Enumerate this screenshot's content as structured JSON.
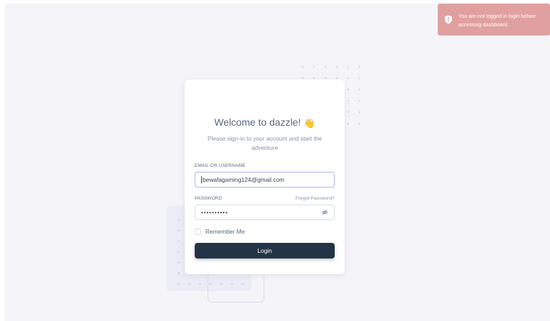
{
  "toast": {
    "line1": "You are not logged in login before",
    "line2": "accessing dashboard",
    "icon": "shield-alert-icon",
    "color": "#e1a0a0"
  },
  "login": {
    "title": "Welcome to dazzle!",
    "title_icon": "waving-hand-icon",
    "subtitle": "Please sign-in to your account and start the adventure",
    "email_label": "EMAIL OR USERNAME",
    "email_value": "bewafagaming124@gmail.com",
    "password_label": "PASSWORD",
    "forgot_label": "Forgot Password?",
    "password_value": "••••••••••",
    "password_toggle_icon": "eye-off-icon",
    "remember_label": "Remember Me",
    "remember_checked": false,
    "login_label": "Login",
    "button_color": "#233446"
  }
}
